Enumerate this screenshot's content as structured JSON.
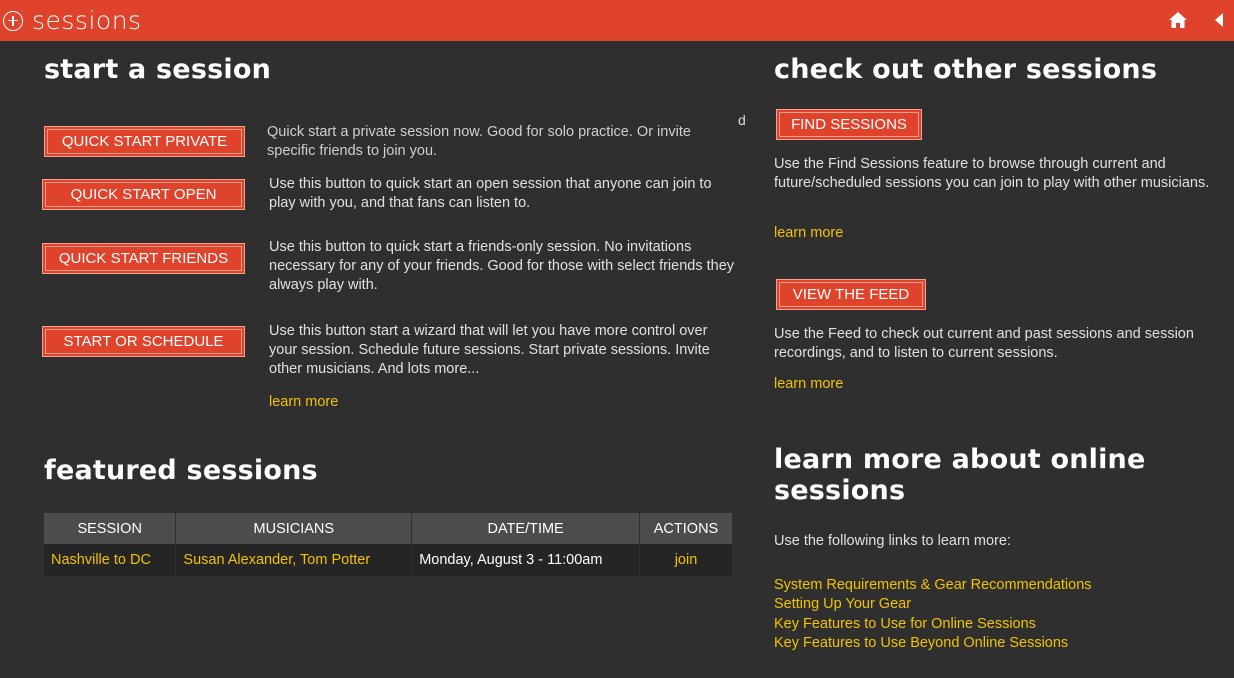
{
  "header": {
    "title": "sessions",
    "plus_icon": "plus-circle-icon",
    "home_icon": "home-icon",
    "back_icon": "triangle-left-icon",
    "color": "#e0432c"
  },
  "start": {
    "heading": "start a session",
    "stray_char": "d",
    "buttons": [
      {
        "label": "QUICK START PRIVATE",
        "desc": "Quick start a private session now. Good for solo practice. Or invite specific friends to join you."
      },
      {
        "label": "QUICK START OPEN",
        "desc": "Use this button to quick start an open session that anyone can join to play with you, and that fans can listen to."
      },
      {
        "label": "QUICK START FRIENDS",
        "desc": "Use this button to quick start a friends-only session. No invitations necessary for any of your friends. Good for those with select friends they always play with."
      },
      {
        "label": "START OR SCHEDULE",
        "desc": "Use this button start a wizard that will let you have more control over your session. Schedule future sessions. Start private sessions. Invite other musicians. And lots more..."
      }
    ],
    "learn_more": "learn more"
  },
  "featured": {
    "heading": "featured sessions",
    "columns": [
      "SESSION",
      "MUSICIANS",
      "DATE/TIME",
      "ACTIONS"
    ],
    "rows": [
      {
        "session": "Nashville to DC",
        "musicians": "Susan Alexander, Tom Potter",
        "datetime": "Monday, August 3 - 11:00am",
        "action": "join"
      }
    ]
  },
  "other": {
    "heading": "check out other sessions",
    "find_button": "FIND SESSIONS",
    "find_desc": "Use the Find Sessions feature to browse through current and future/scheduled sessions you can join to play with other musicians.",
    "find_learn_more": "learn more",
    "feed_button": "VIEW THE FEED",
    "feed_desc": "Use the Feed to check out current and past sessions and session recordings, and to listen to current sessions.",
    "feed_learn_more": "learn more"
  },
  "learn": {
    "heading_line1": "learn more about online",
    "heading_line2": "sessions",
    "intro": "Use the following links to learn more:",
    "links": [
      "System Requirements & Gear Recommendations",
      "Setting Up Your Gear",
      "Key Features to Use for Online Sessions",
      "Key Features to Use Beyond Online Sessions"
    ]
  }
}
